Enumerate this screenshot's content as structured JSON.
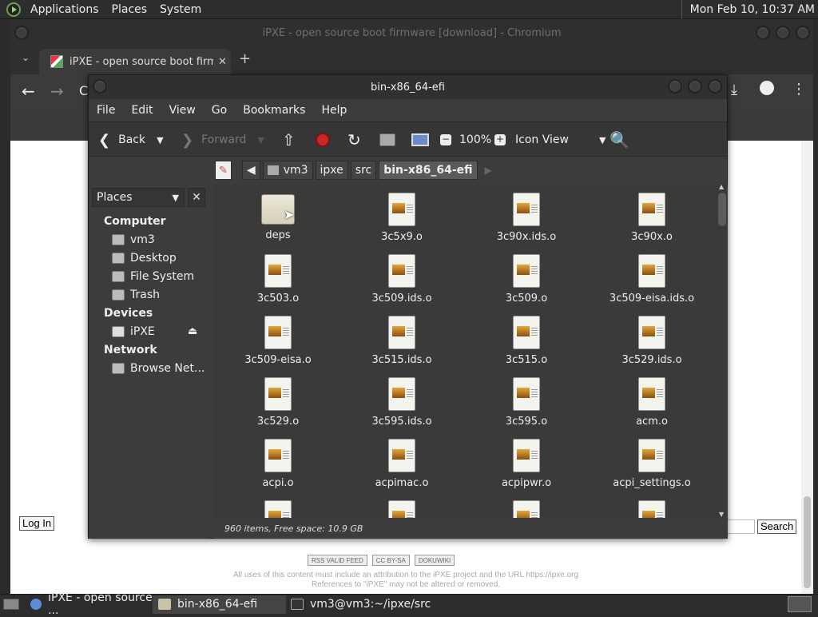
{
  "top_panel": {
    "menus": [
      "Applications",
      "Places",
      "System"
    ],
    "clock": "Mon Feb 10, 10:37 AM"
  },
  "browser": {
    "window_title": "iPXE - open source boot firmware [download] - Chromium",
    "tab_title": "iPXE - open source boot firm",
    "login_button": "Log In",
    "search_button": "Search",
    "badges": [
      "RSS VALID FEED",
      "CC BY-SA",
      "DOKUWIKI"
    ],
    "footer_line1": "All uses of this content must include an attribution to the iPXE project and the URL https://ipxe.org",
    "footer_line2": "References to \"iPXE\" may not be altered or removed."
  },
  "file_manager": {
    "window_title": "bin-x86_64-efi",
    "menu": [
      "File",
      "Edit",
      "View",
      "Go",
      "Bookmarks",
      "Help"
    ],
    "toolbar": {
      "back": "Back",
      "forward": "Forward",
      "zoom": "100%",
      "view_mode": "Icon View"
    },
    "breadcrumbs": [
      "vm3",
      "ipxe",
      "src",
      "bin-x86_64-efi"
    ],
    "sidebar": {
      "combo": "Places",
      "sections": [
        {
          "title": "Computer",
          "items": [
            "vm3",
            "Desktop",
            "File System",
            "Trash"
          ]
        },
        {
          "title": "Devices",
          "items": [
            "iPXE"
          ]
        },
        {
          "title": "Network",
          "items": [
            "Browse Net..."
          ]
        }
      ]
    },
    "files": [
      "deps",
      "3c5x9.o",
      "3c90x.ids.o",
      "3c90x.o",
      "3c503.o",
      "3c509.ids.o",
      "3c509.o",
      "3c509-eisa.ids.o",
      "3c509-eisa.o",
      "3c515.ids.o",
      "3c515.o",
      "3c529.ids.o",
      "3c529.o",
      "3c595.ids.o",
      "3c595.o",
      "acm.o",
      "acpi.o",
      "acpimac.o",
      "acpipwr.o",
      "acpi_settings.o"
    ],
    "status": "960 items, Free space: 10.9 GB"
  },
  "taskbar": {
    "tasks": [
      "iPXE - open source ...",
      "bin-x86_64-efi",
      "vm3@vm3:~/ipxe/src"
    ]
  }
}
